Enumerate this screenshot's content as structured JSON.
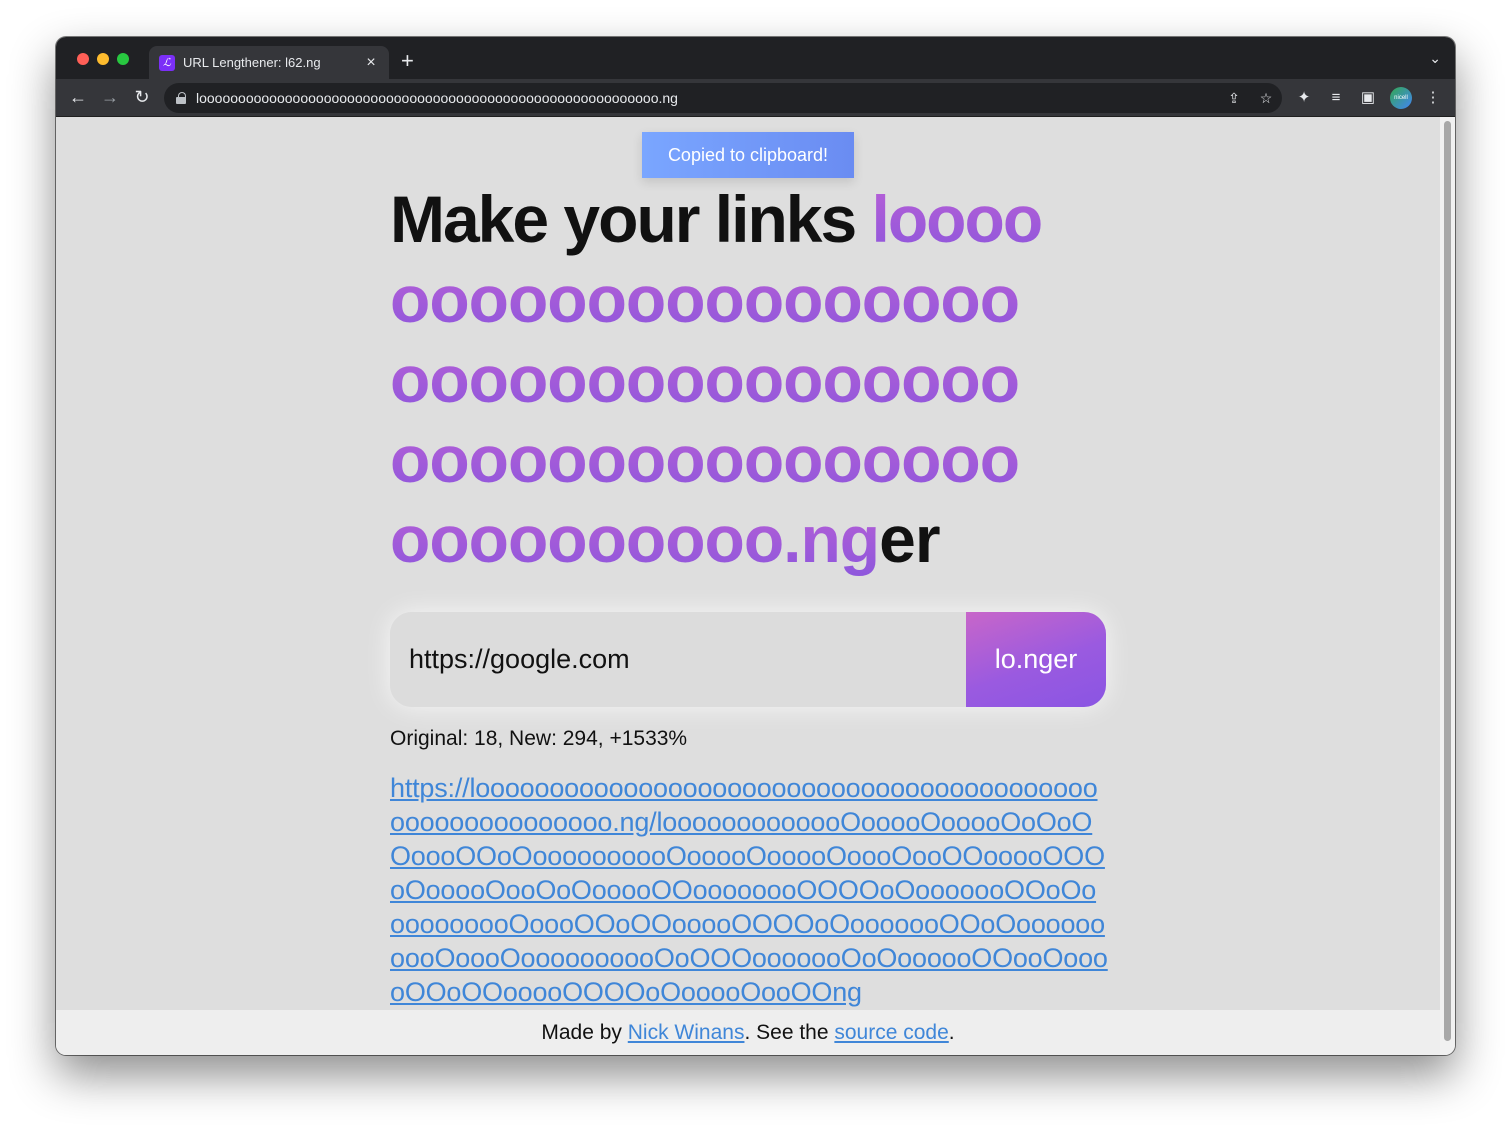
{
  "browser": {
    "tab_title": "URL Lengthener: l62.ng",
    "tab_favicon_letter": "ℒ",
    "url": "looooooooooooooooooooooooooooooooooooooooooooooooooooooooooo.ng",
    "avatar_label": "nicell"
  },
  "page": {
    "toast": "Copied to clipboard!",
    "headline": {
      "line1_dark": "Make your links ",
      "line1_accent": "loooo",
      "line2": "oooooooooooooooo",
      "line3": "oooooooooooooooo",
      "line4": "oooooooooooooooo",
      "line5_accent": "oooooooooo.ng",
      "line5_dark": "er"
    },
    "input_value": "https://google.com",
    "submit_label": "lo.nger",
    "stats": "Original: 18, New: 294, +1533%",
    "result_url": "https://looooooooooooooooooooooooooooooooooooooooooooooooooooooooo.ng/looooooooooooOooooOooooOoOoOOoooOOoOoooooooooOooooOooooOoooOooOOooooOOOoOooooOooOoOooooOOoooooooOOOOoOooooooOOoOoooooooooOoooOOoOOooooOOOOoOooooooOOoOoooooooooOoooOoooooooooOoOOOooooooOoOoooooOOooOooooOOoOOooooOOOOoOooooOooOOng",
    "footer": {
      "prefix": "Made by ",
      "author": "Nick Winans",
      "middle": ". See the ",
      "source_link": "source code",
      "suffix": "."
    }
  },
  "colors": {
    "accent_gradient_top": "#b85fd6",
    "accent_gradient_bottom": "#8e57dc",
    "link": "#3f86d8",
    "toast": "#7aa6ff"
  }
}
